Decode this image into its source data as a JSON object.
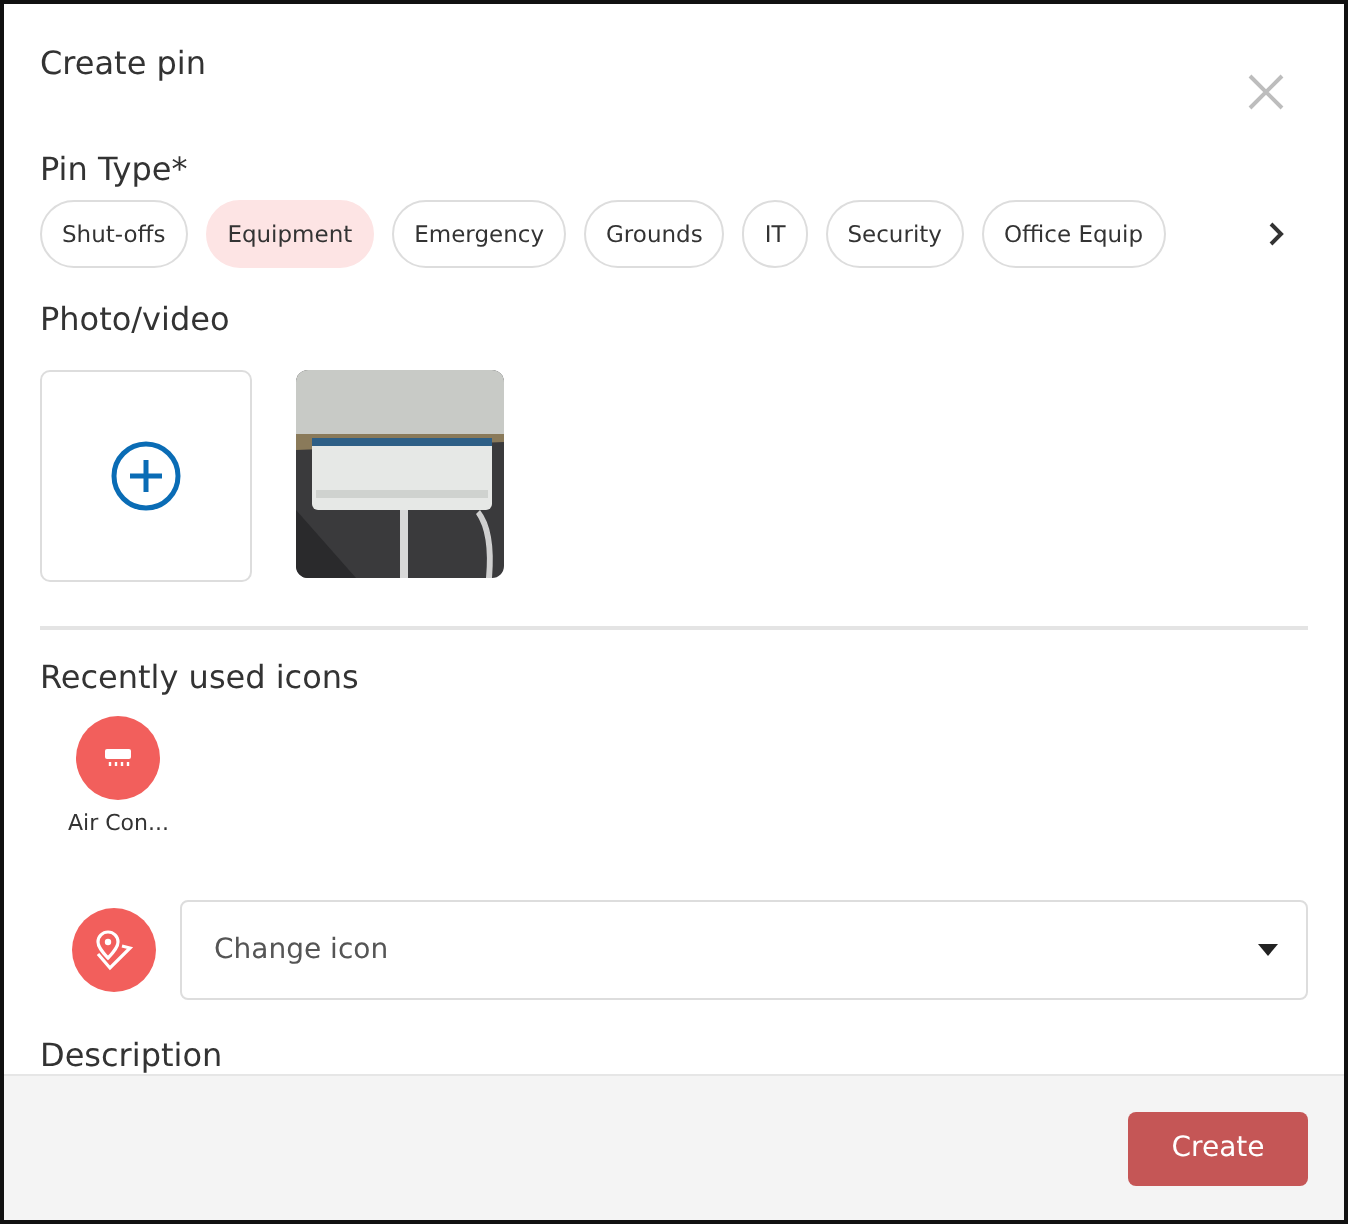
{
  "dialog": {
    "title": "Create pin"
  },
  "pin_type": {
    "label": "Pin Type*",
    "chips": [
      {
        "label": "Shut-offs",
        "selected": false
      },
      {
        "label": "Equipment",
        "selected": true
      },
      {
        "label": "Emergency",
        "selected": false
      },
      {
        "label": "Grounds",
        "selected": false
      },
      {
        "label": "IT",
        "selected": false
      },
      {
        "label": "Security",
        "selected": false
      },
      {
        "label": "Office Equip",
        "selected": false
      }
    ]
  },
  "photo_video": {
    "label": "Photo/video"
  },
  "recent_icons": {
    "label": "Recently used icons",
    "items": [
      {
        "label": "Air Con..."
      }
    ]
  },
  "change_icon": {
    "placeholder": "Change icon"
  },
  "description": {
    "label": "Description"
  },
  "footer": {
    "button": "Create"
  }
}
